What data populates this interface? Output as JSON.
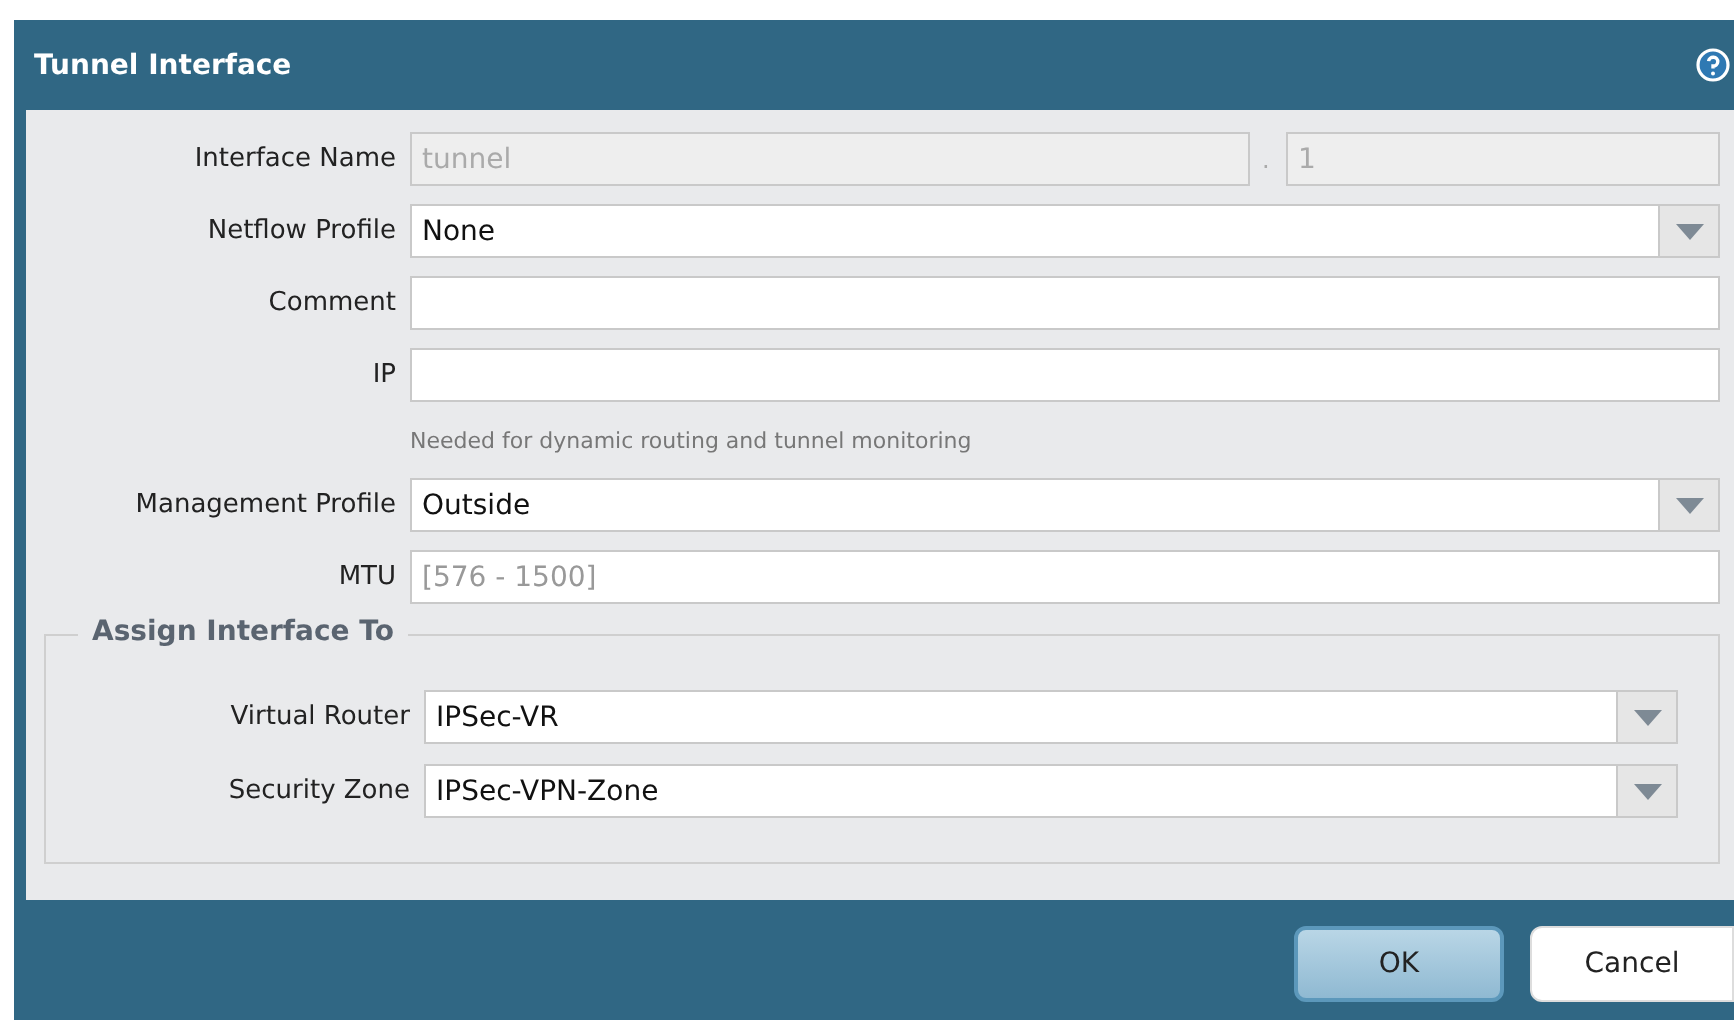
{
  "window": {
    "title": "Tunnel Interface"
  },
  "fields": [
    {
      "kind": "split",
      "label": "Interface Name",
      "value": "tunnel",
      "separator": ".",
      "suffix": "1",
      "disabled": true
    },
    {
      "kind": "select",
      "label": "Netflow Profile",
      "value": "None",
      "disabled": false
    },
    {
      "kind": "text",
      "label": "Comment",
      "disabled": false
    },
    {
      "kind": "text",
      "label": "IP",
      "hint": "Needed for dynamic routing and tunnel monitoring",
      "disabled": false
    },
    {
      "kind": "select",
      "label": "Management Profile",
      "value": "Outside",
      "disabled": false
    },
    {
      "kind": "text",
      "label": "MTU",
      "placeholder": "[576 - 1500]",
      "disabled": false
    }
  ],
  "assign": {
    "legend": "Assign Interface To",
    "fields": [
      {
        "kind": "select",
        "label": "Virtual Router",
        "value": "IPSec-VR",
        "disabled": false
      },
      {
        "kind": "select",
        "label": "Security Zone",
        "value": "IPSec-VPN-Zone",
        "disabled": false
      }
    ]
  },
  "buttons": [
    {
      "label": "OK",
      "primary": true
    },
    {
      "label": "Cancel",
      "primary": false
    }
  ]
}
